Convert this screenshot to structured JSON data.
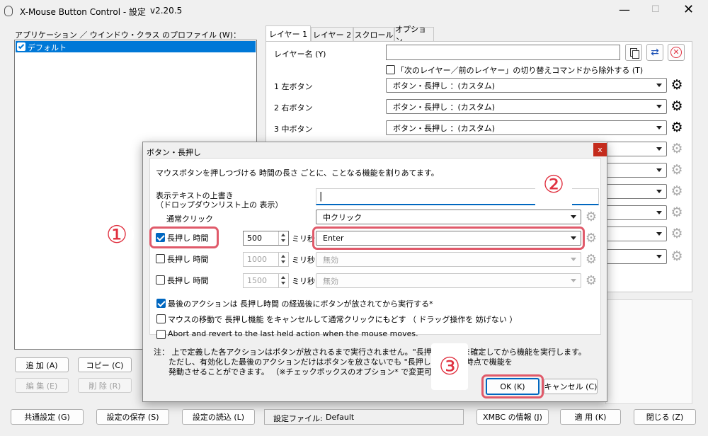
{
  "window": {
    "title": "X-Mouse Button Control - 設定",
    "version": "v2.20.5"
  },
  "profiles": {
    "label": "アプリケーション ／ ウインドウ・クラス のプロファイル (W)：",
    "items": [
      {
        "label": "デフォルト",
        "checked": true
      }
    ],
    "buttons": {
      "add": "追 加  (A)",
      "copy": "コピー  (C)",
      "edit": "編 集  (E)",
      "delete": "削 除  (R)"
    }
  },
  "tabs": [
    "レイヤー 1",
    "レイヤー 2",
    "スクロール",
    "オプション"
  ],
  "layer": {
    "name_label": "レイヤー名 (Y)",
    "name_value": "",
    "exclude_label": "「次のレイヤー／前のレイヤー」の切り替えコマンドから除外する  (T)",
    "rows": [
      {
        "label": "1  左ボタン",
        "value": "ボタン・長押し ：(カスタム)"
      },
      {
        "label": "2  右ボタン",
        "value": "ボタン・長押し ：(カスタム)"
      },
      {
        "label": "3  中ボタン",
        "value": "ボタン・長押し ：(カスタム)"
      }
    ]
  },
  "dialog": {
    "title": "ボタン・長押し",
    "close": "x",
    "description": "マウスボタンを押しつづける 時間の長さ ごとに、ことなる機能を割りあてます。",
    "override_label_1": "表示テキストの上書き",
    "override_label_2": "（ドロップダウンリスト上の 表示）",
    "override_value": "|",
    "normal_click_label": "通常クリック",
    "normal_click_value": "中クリック",
    "hold_label": "長押し 時間",
    "ms_label": "ミリ秒",
    "holds": [
      {
        "enabled": true,
        "time": "500",
        "action": "Enter"
      },
      {
        "enabled": false,
        "time": "1000",
        "action": "無効"
      },
      {
        "enabled": false,
        "time": "1500",
        "action": "無効"
      }
    ],
    "options": [
      {
        "checked": true,
        "label": "最後のアクションは 長押し時間 の経過後にボタンが放されてから実行する*"
      },
      {
        "checked": false,
        "label": "マウスの移動で 長押し機能 をキャンセルして通常クリックにもどす （ ドラッグ操作を 妨げない ）"
      },
      {
        "checked": false,
        "label": "Abort and revert to the last held action when the mouse moves."
      }
    ],
    "note_1": "注：  上で定義した各アクションはボタンが放されるまで実行されません。\"長押ししたまま確定してから機能を実行します。",
    "note_2": "ただし、有効化した最後のアクションだけはボタンを放さないでも \"長押し時間\"経過時点で機能を",
    "note_3": "発動させることができます。  （※チェックボックスのオプション* で変更可 ）",
    "ok": "OK  (K)",
    "cancel": "キャンセル (C)"
  },
  "bottom": {
    "common": "共通設定 (G)",
    "save": "設定の保存 (S)",
    "load": "設定の読込 (L)",
    "file_label": "設定ファイル:",
    "file_value": "Default",
    "info": "XMBC の情報 (J)",
    "apply": "適 用  (K)",
    "close": "閉じる (Z)"
  },
  "annotations": [
    "①",
    "②",
    "③"
  ],
  "colors": {
    "accent": "#0067c0",
    "highlight": "#e05a6a",
    "selection": "#0078d7"
  }
}
